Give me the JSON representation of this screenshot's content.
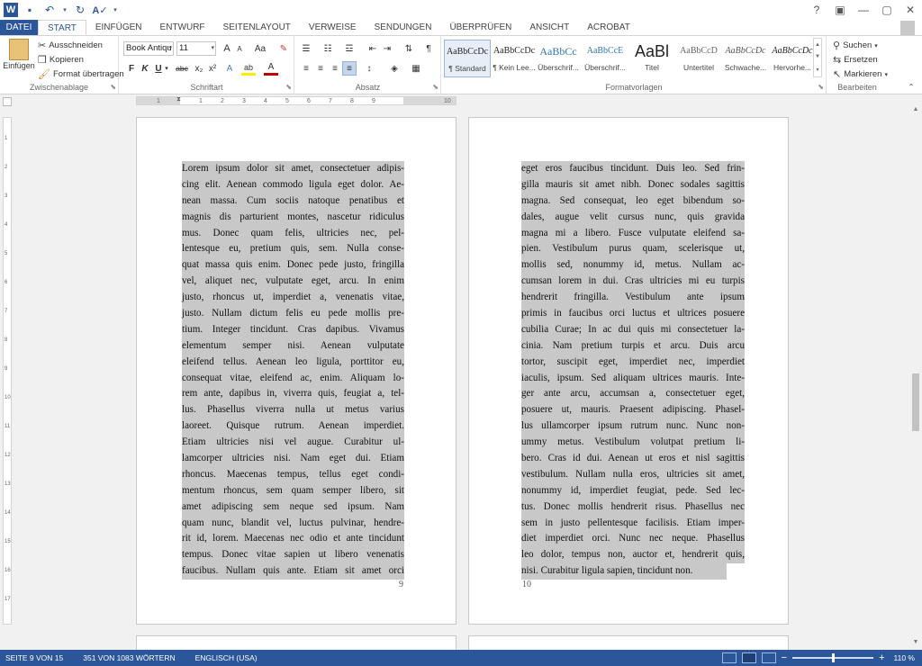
{
  "quick_access": {
    "app_icon": "word-logo",
    "save_icon": "save-icon",
    "undo_icon": "undo-icon",
    "redo_icon": "redo-icon",
    "spellcheck_icon": "spellcheck-icon",
    "customize_icon": "chevron-down-icon"
  },
  "window_controls": {
    "help": "?",
    "ribbon_options": "▣",
    "minimize": "—",
    "maximize": "▢",
    "close": "✕"
  },
  "tabs": [
    "DATEI",
    "START",
    "EINFÜGEN",
    "ENTWURF",
    "SEITENLAYOUT",
    "VERWEISE",
    "SENDUNGEN",
    "ÜBERPRÜFEN",
    "ANSICHT",
    "ACROBAT"
  ],
  "active_tab": "START",
  "ribbon": {
    "clipboard": {
      "label": "Zwischenablage",
      "paste": "Einfügen",
      "cut": "Ausschneiden",
      "copy": "Kopieren",
      "format_painter": "Format übertragen"
    },
    "font": {
      "label": "Schriftart",
      "font_name": "Book Antiqu",
      "font_size": "11",
      "bold": "F",
      "italic": "K",
      "underline": "U",
      "strikethrough": "abc",
      "subscript": "x₂",
      "superscript": "x²",
      "grow": "A",
      "shrink": "A",
      "case": "Aa",
      "clear": "✎",
      "effects": "A",
      "highlight": "ab",
      "font_color": "A"
    },
    "paragraph": {
      "label": "Absatz",
      "show_marks": "¶"
    },
    "styles": {
      "label": "Formatvorlagen",
      "items": [
        {
          "preview": "AaBbCcDc",
          "name": "¶ Standard"
        },
        {
          "preview": "AaBbCcDc",
          "name": "¶ Kein Lee..."
        },
        {
          "preview": "AaBbCc",
          "name": "Überschrif..."
        },
        {
          "preview": "AaBbCcE",
          "name": "Überschrif..."
        },
        {
          "preview": "AaBl",
          "name": "Titel"
        },
        {
          "preview": "AaBbCcD",
          "name": "Untertitel"
        },
        {
          "preview": "AaBbCcDc",
          "name": "Schwache..."
        },
        {
          "preview": "AaBbCcDc",
          "name": "Hervorhe..."
        }
      ]
    },
    "editing": {
      "label": "Bearbeiten",
      "find": "Suchen",
      "replace": "Ersetzen",
      "select": "Markieren"
    }
  },
  "ruler": {
    "numbers": [
      "1",
      "1",
      "2",
      "3",
      "4",
      "5",
      "6",
      "7",
      "8",
      "9",
      "10"
    ],
    "vnumbers": [
      "1",
      "2",
      "3",
      "4",
      "5",
      "6",
      "7",
      "8",
      "9",
      "10",
      "11",
      "12",
      "13",
      "14",
      "15",
      "16",
      "17"
    ]
  },
  "pages": [
    {
      "number": "9",
      "lines": [
        "Lorem ipsum dolor sit amet, consectetuer adipis-",
        "cing elit. Aenean commodo ligula eget dolor. Ae-",
        "nean massa. Cum sociis natoque penatibus et",
        "magnis dis parturient montes, nascetur ridiculus",
        "mus. Donec quam felis, ultricies nec, pel-",
        "lentesque eu, pretium quis, sem. Nulla conse-",
        "quat massa quis enim. Donec pede justo, fringilla",
        "vel, aliquet nec, vulputate eget, arcu. In enim",
        "justo, rhoncus ut, imperdiet a, venenatis vitae,",
        "justo. Nullam dictum felis eu pede mollis pre-",
        "tium. Integer tincidunt. Cras dapibus. Vivamus",
        "elementum semper nisi. Aenean vulputate",
        "eleifend tellus. Aenean leo ligula, porttitor eu,",
        "consequat vitae, eleifend ac, enim. Aliquam lo-",
        "rem ante, dapibus in, viverra quis, feugiat a, tel-",
        "lus. Phasellus viverra nulla ut metus varius",
        "laoreet. Quisque rutrum. Aenean imperdiet.",
        "Etiam ultricies nisi vel augue. Curabitur ul-",
        "lamcorper ultricies nisi. Nam eget dui. Etiam",
        "rhoncus. Maecenas tempus, tellus eget condi-",
        "mentum rhoncus, sem quam semper libero, sit",
        "amet adipiscing sem neque sed ipsum. Nam",
        "quam nunc, blandit vel, luctus pulvinar, hendre-",
        "rit id, lorem. Maecenas nec odio et ante tincidunt",
        "tempus. Donec vitae sapien ut libero venenatis",
        "faucibus. Nullam quis ante. Etiam sit amet orci"
      ]
    },
    {
      "number": "10",
      "lines": [
        "eget eros faucibus tincidunt. Duis leo. Sed frin-",
        "gilla mauris sit amet nibh. Donec sodales sagittis",
        "magna. Sed consequat, leo eget bibendum so-",
        "dales, augue velit cursus nunc, quis gravida",
        "magna mi a libero. Fusce vulputate eleifend sa-",
        "pien. Vestibulum purus quam, scelerisque ut,",
        "mollis sed, nonummy id, metus. Nullam ac-",
        "cumsan lorem in dui. Cras ultricies mi eu turpis",
        "hendrerit fringilla. Vestibulum ante ipsum",
        "primis in faucibus orci luctus et ultrices posuere",
        "cubilia Curae; In ac dui quis mi consectetuer la-",
        "cinia. Nam pretium turpis et arcu. Duis arcu",
        "tortor, suscipit eget, imperdiet nec, imperdiet",
        "iaculis, ipsum. Sed aliquam ultrices mauris. Inte-",
        "ger ante arcu, accumsan a, consectetuer eget,",
        "posuere ut, mauris. Praesent adipiscing. Phasel-",
        "lus ullamcorper ipsum rutrum nunc. Nunc non-",
        "ummy metus. Vestibulum volutpat pretium li-",
        "bero. Cras id dui. Aenean ut eros et nisl sagittis",
        "vestibulum. Nullam nulla eros, ultricies sit amet,",
        "nonummy id, imperdiet feugiat, pede. Sed lec-",
        "tus. Donec mollis hendrerit risus. Phasellus nec",
        "sem in justo pellentesque facilisis. Etiam imper-",
        "diet imperdiet orci. Nunc nec neque. Phasellus",
        "leo dolor, tempus non, auctor et, hendrerit quis,",
        "nisi. Curabitur ligula sapien, tincidunt non."
      ]
    }
  ],
  "statusbar": {
    "page": "SEITE 9 VON 15",
    "words": "351 VON 1083 WÖRTERN",
    "language": "ENGLISCH (USA)",
    "zoom_minus": "−",
    "zoom_plus": "+",
    "zoom": "110 %"
  },
  "colors": {
    "accent": "#2b579a",
    "selection": "#c8c8c8"
  }
}
